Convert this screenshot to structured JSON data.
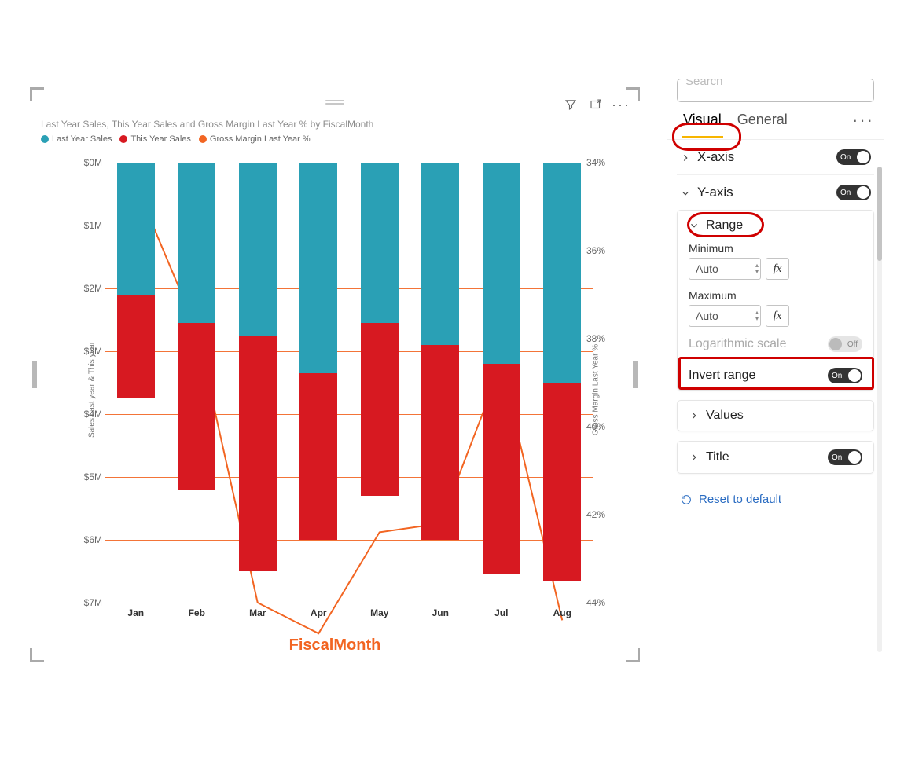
{
  "chart_data": {
    "type": "bar",
    "title": "Last Year Sales, This Year Sales and Gross Margin Last Year % by FiscalMonth",
    "xlabel": "FiscalMonth",
    "ylabel": "Sales Last year & This year",
    "y2label": "Gross Margin Last Year %",
    "ylim": [
      0,
      7
    ],
    "y_inverted": true,
    "y_ticks": [
      "$0M",
      "$1M",
      "$2M",
      "$3M",
      "$4M",
      "$5M",
      "$6M",
      "$7M"
    ],
    "y2_ticks": [
      "34%",
      "36%",
      "38%",
      "40%",
      "42%",
      "44%"
    ],
    "categories": [
      "Jan",
      "Feb",
      "Mar",
      "Apr",
      "May",
      "Jun",
      "Jul",
      "Aug"
    ],
    "series": [
      {
        "name": "Last Year Sales",
        "color": "#2aa0b5",
        "values_M": [
          2.1,
          2.55,
          2.75,
          3.35,
          2.55,
          2.9,
          3.2,
          3.5
        ]
      },
      {
        "name": "This Year Sales",
        "color": "#d71921",
        "values_M": [
          1.65,
          2.65,
          3.75,
          2.65,
          2.75,
          3.1,
          3.35,
          3.15
        ]
      }
    ],
    "line_series": {
      "name": "Gross Margin Last Year %",
      "color": "#f26522",
      "values_pct": [
        34.5,
        37.8,
        44.0,
        44.7,
        42.4,
        42.2,
        38.6,
        44.4
      ]
    }
  },
  "chart": {
    "legend": [
      {
        "label": "Last Year Sales",
        "color": "#2aa0b5"
      },
      {
        "label": "This Year Sales",
        "color": "#d71921"
      },
      {
        "label": "Gross Margin Last Year %",
        "color": "#f26522"
      }
    ]
  },
  "pane": {
    "search_placeholder": "Search",
    "tabs": {
      "visual": "Visual",
      "general": "General"
    },
    "xaxis": {
      "label": "X-axis",
      "toggle": "On"
    },
    "yaxis": {
      "label": "Y-axis",
      "toggle": "On",
      "range": {
        "label": "Range",
        "min_label": "Minimum",
        "min_value": "Auto",
        "max_label": "Maximum",
        "max_value": "Auto",
        "log_label": "Logarithmic scale",
        "log_toggle": "Off",
        "invert_label": "Invert range",
        "invert_toggle": "On"
      }
    },
    "values": {
      "label": "Values"
    },
    "title": {
      "label": "Title",
      "toggle": "On"
    },
    "reset": "Reset to default",
    "fx": "fx"
  }
}
